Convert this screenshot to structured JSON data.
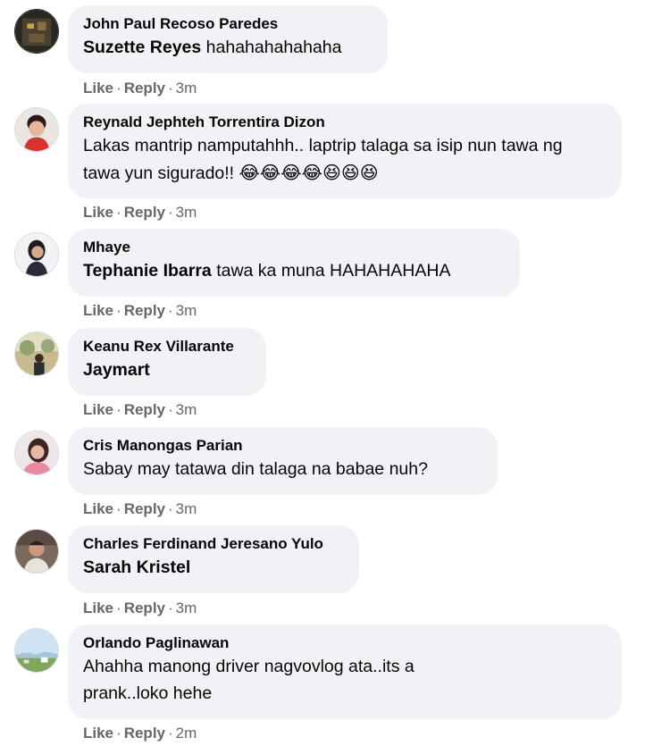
{
  "comments": [
    {
      "author": "John Paul Recoso Paredes",
      "mention": "Suzette Reyes",
      "text": "hahahahahahaha",
      "like_label": "Like",
      "reply_label": "Reply",
      "separator": "·",
      "time": "3m",
      "avatar_icon": "profile-photo-dark"
    },
    {
      "author": "Reynald Jephteh Torrentira Dizon",
      "mention": "",
      "text": "Lakas mantrip namputahhh.. laptrip talaga sa isip nun tawa ng tawa yun sigurado!!",
      "emojis": "😂😂😂😂😆😆😆",
      "like_label": "Like",
      "reply_label": "Reply",
      "separator": "·",
      "time": "3m",
      "avatar_icon": "profile-photo-child"
    },
    {
      "author": "Mhaye",
      "mention": "Tephanie Ibarra",
      "text": "tawa ka muna HAHAHAHAHA",
      "like_label": "Like",
      "reply_label": "Reply",
      "separator": "·",
      "time": "3m",
      "avatar_icon": "profile-photo-woman"
    },
    {
      "author": "Keanu Rex Villarante",
      "mention": "Jaymart",
      "text": "",
      "like_label": "Like",
      "reply_label": "Reply",
      "separator": "·",
      "time": "3m",
      "avatar_icon": "profile-photo-outdoor"
    },
    {
      "author": "Cris Manongas Parian",
      "mention": "",
      "text": "Sabay may tatawa din talaga na babae nuh?",
      "like_label": "Like",
      "reply_label": "Reply",
      "separator": "·",
      "time": "3m",
      "avatar_icon": "profile-photo-woman-pink"
    },
    {
      "author": "Charles Ferdinand Jeresano Yulo",
      "mention": "Sarah Kristel",
      "text": "",
      "like_label": "Like",
      "reply_label": "Reply",
      "separator": "·",
      "time": "3m",
      "avatar_icon": "profile-photo-man"
    },
    {
      "author": "Orlando Paglinawan",
      "mention": "",
      "text": "Ahahha manong driver nagvovlog ata..its a prank..loko hehe",
      "like_label": "Like",
      "reply_label": "Reply",
      "separator": "·",
      "time": "2m",
      "avatar_icon": "profile-photo-landscape"
    }
  ]
}
